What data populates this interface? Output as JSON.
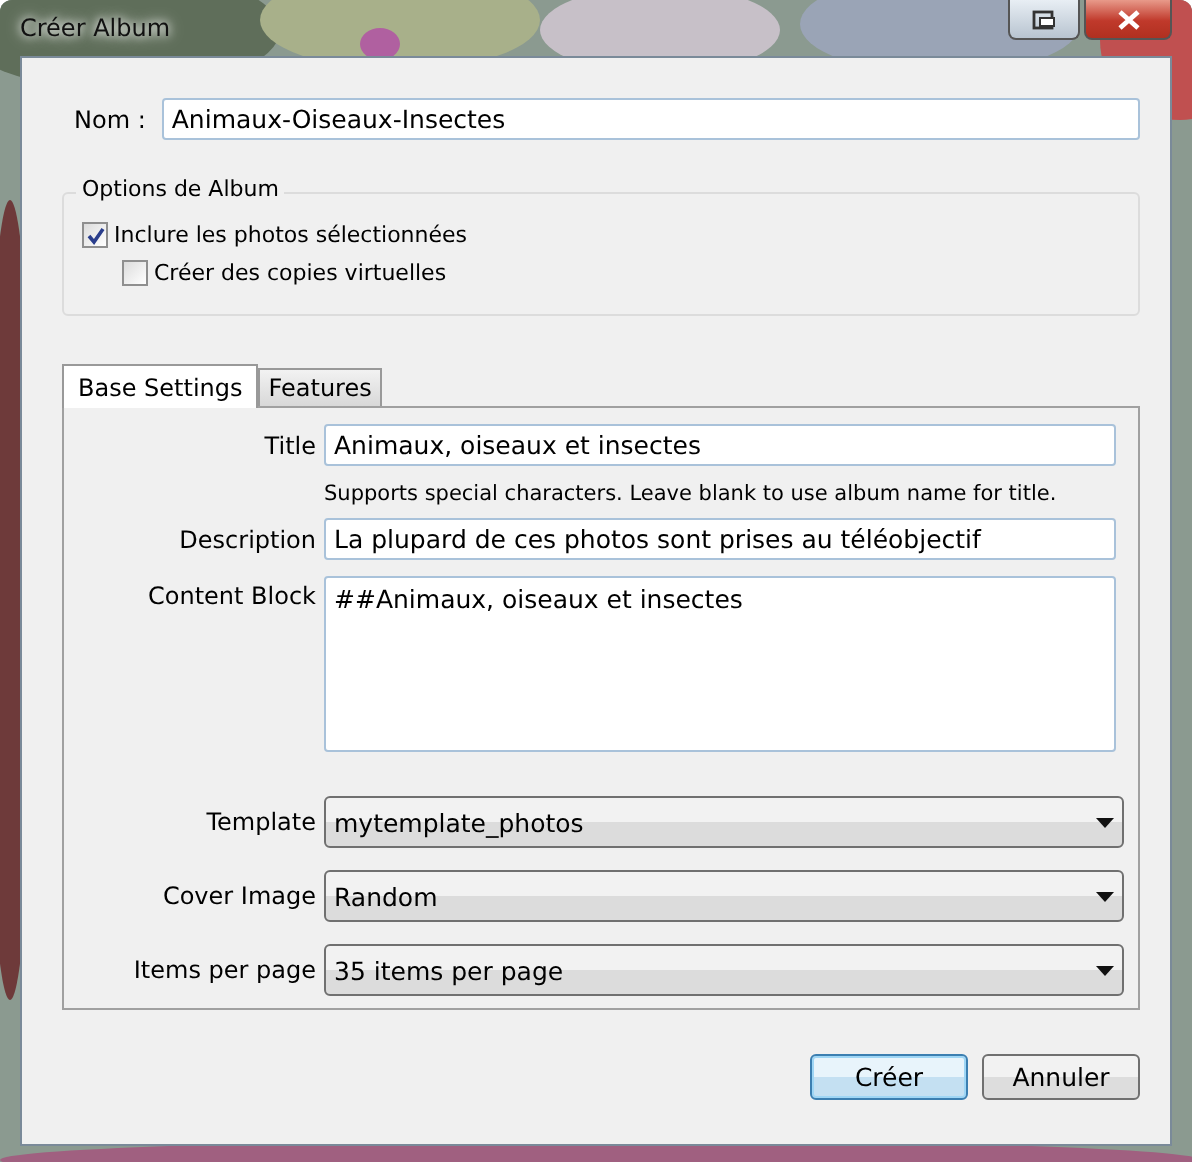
{
  "window": {
    "title": "Créer Album"
  },
  "name": {
    "label": "Nom :",
    "value": "Animaux-Oiseaux-Insectes"
  },
  "options": {
    "title": "Options de Album",
    "checkboxes": [
      {
        "label": "Inclure les photos sélectionnées",
        "checked": true,
        "children": [
          {
            "label": "Créer des copies virtuelles",
            "checked": false
          }
        ]
      }
    ]
  },
  "tabs": [
    {
      "label": "Base Settings",
      "selected": true
    },
    {
      "label": "Features",
      "selected": false
    }
  ],
  "fields": [
    {
      "kind": "text",
      "label": "Title",
      "value": "Animaux, oiseaux et insectes",
      "help": "Supports special characters.  Leave blank to use album name for title."
    },
    {
      "kind": "text",
      "label": "Description",
      "value": "La plupard de ces photos sont prises au téléobjectif"
    },
    {
      "kind": "textarea",
      "label": "Content Block",
      "value": "##Animaux, oiseaux et insectes"
    },
    {
      "kind": "select",
      "label": "Template",
      "value": "mytemplate_photos"
    },
    {
      "kind": "select",
      "label": "Cover Image",
      "value": "Random"
    },
    {
      "kind": "select",
      "label": "Items per page",
      "value": "35 items per page"
    }
  ],
  "buttons": [
    {
      "label": "Créer",
      "default": true
    },
    {
      "label": "Annuler",
      "default": false
    }
  ]
}
